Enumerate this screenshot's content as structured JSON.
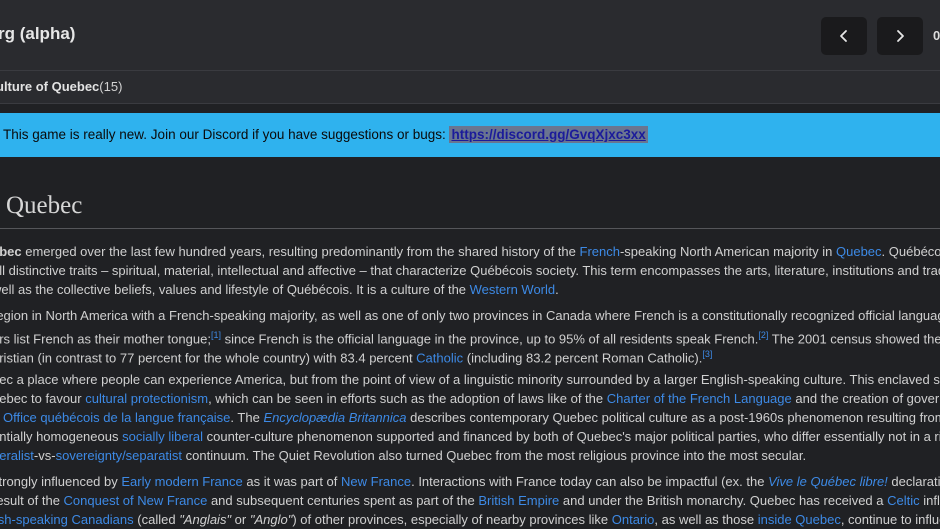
{
  "header": {
    "brand": "rg (alpha)",
    "counter": "0"
  },
  "path": {
    "title": "ulture of Quebec",
    "count": "(15)"
  },
  "banner": {
    "text": "This game is really new. Join our Discord if you have suggestions or bugs:",
    "link": "https://discord.gg/GvqXjxc3xx"
  },
  "article": {
    "heading": "Quebec",
    "p1": {
      "l1a": "ebec",
      "l1b": " emerged over the last few hundred years, resulting predominantly from the shared history of the ",
      "l1c": "French",
      "l1d": "-speaking North American majority in ",
      "l1e": "Quebec",
      "l1f": ". Québécois",
      "l2": "all distinctive traits – spiritual, material, intellectual and affective – that characterize Québécois society. This term encompasses the arts, literature, institutions and tradi",
      "l3a": "well as the collective beliefs, values and lifestyle of Québécois. It is a culture of the ",
      "l3b": "Western World",
      "l3c": "."
    },
    "p2": {
      "l1": "region in North America with a French-speaking majority, as well as one of only two provinces in Canada where French is a constitutionally recognized official languag",
      "l2a": "ers list French as their mother tongue;",
      "l2b": "[1]",
      "l2c": " since French is the official language in the province, up to 95% of all residents speak French.",
      "l2d": "[2]",
      "l2e": " The 2001 census showed the",
      "l3a": "hristian (in contrast to 77 percent for the whole country) with 83.4 percent ",
      "l3b": "Catholic",
      "l3c": " (including 83.2 percent Roman Catholic).",
      "l3d": "[3]"
    },
    "p3": {
      "l1": "bec a place where people can experience America, but from the point of view of a linguistic minority surrounded by a larger English-speaking culture. This enclaved sta",
      "l2a": "uebec to favour ",
      "l2b": "cultural protectionism",
      "l2c": ", which can be seen in efforts such as the adoption of laws like of the ",
      "l2d": "Charter of the French Language",
      "l2e": " and the creation of governm",
      "l3a": "Office québécois de la langue française",
      "l3b": ". The ",
      "l3c": "Encyclopædia Britannica",
      "l3d": " describes contemporary Quebec political culture as a post-1960s phenomenon resulting from th",
      "l4a": "entially homogeneous ",
      "l4b": "socially liberal",
      "l4c": " counter-culture phenomenon supported and financed by both of Quebec's major political parties, who differ essentially not in a rig",
      "l5a": "deralist",
      "l5b": "-vs-",
      "l5c": "sovereignty/separatist",
      "l5d": " continuum. The Quiet Revolution also turned Quebec from the most religious province into the most secular."
    },
    "p4": {
      "l1a": "strongly influenced by ",
      "l1b": "Early modern France",
      "l1c": " as it was part of ",
      "l1d": "New France",
      "l1e": ". Interactions with France today can also be impactful (ex. the ",
      "l1f": "Vive le Québec libre!",
      "l1g": " declaration",
      "l2a": "result of the ",
      "l2b": "Conquest of New France",
      "l2c": " and subsequent centuries spent as part of the ",
      "l2d": "British Empire",
      "l2e": " and under the British monarchy. Quebec has received a ",
      "l2f": "Celtic",
      "l2g": " influ",
      "l3a": "lish-speaking Canadians",
      "l3b": " (called ",
      "l3c": "\"Anglais\"",
      "l3d": " or ",
      "l3e": "\"Anglo\"",
      "l3f": ") of other provinces, especially of nearby provinces like ",
      "l3g": "Ontario",
      "l3h": ", as well as those ",
      "l3i": "inside Quebec",
      "l3j": ", continue to influe"
    }
  }
}
